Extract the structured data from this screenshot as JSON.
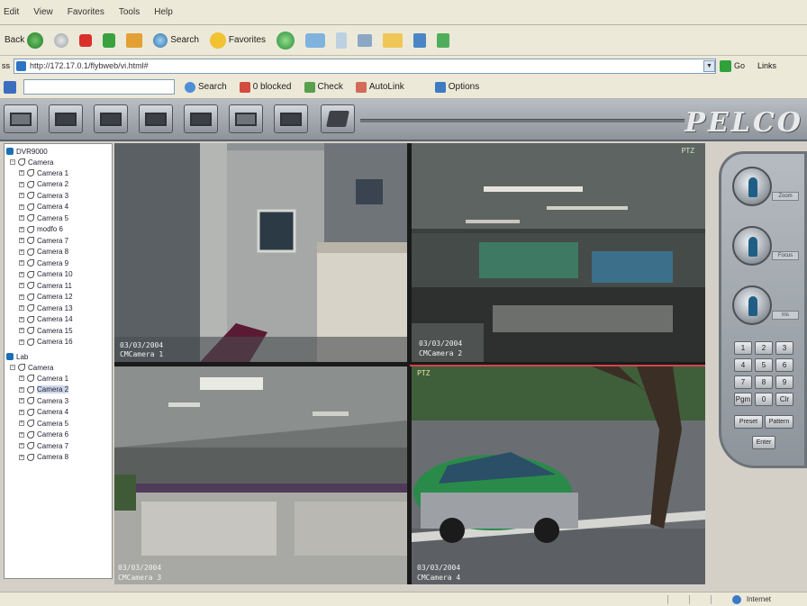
{
  "menu": [
    "Edit",
    "View",
    "Favorites",
    "Tools",
    "Help"
  ],
  "toolbar": {
    "back_label": "Back",
    "search_label": "Search",
    "favorites_label": "Favorites"
  },
  "address": {
    "label": "ss",
    "url": "http://172.17.0.1/flybweb/vi.html#",
    "go_label": "Go",
    "links_label": "Links"
  },
  "google_bar": {
    "search_label": "Search",
    "blocked_label": "0 blocked",
    "check_label": "Check",
    "autolink_label": "AutoLink",
    "options_label": "Options"
  },
  "logo": "PELCO",
  "tree": {
    "group1": {
      "name": "DVR9000",
      "category": "Camera",
      "cameras": [
        "Camera 1",
        "Camera 2",
        "Camera 3",
        "Camera 4",
        "Camera 5",
        "modfo 6",
        "Camera 7",
        "Camera 8",
        "Camera 9",
        "Camera 10",
        "Camera 11",
        "Camera 12",
        "Camera 13",
        "Camera 14",
        "Camera 15",
        "Camera 16"
      ]
    },
    "group2": {
      "name": "Lab",
      "category": "Camera",
      "cameras": [
        "Camera 1",
        "Camera 2",
        "Camera 3",
        "Camera 4",
        "Camera 5",
        "Camera 6",
        "Camera 7",
        "Camera 8"
      ]
    },
    "selected": "group2:Camera 2"
  },
  "video": {
    "tile1": {
      "osd_time": "03/03/2004",
      "osd_name": "CMCamera 1"
    },
    "tile2": {
      "osd_time": "03/03/2004",
      "osd_name": "CMCamera 2",
      "osd_corner": "PTZ"
    },
    "tile3": {
      "osd_time": "03/03/2004",
      "osd_name": "CMCamera 3"
    },
    "tile4": {
      "osd_top": "PTZ",
      "osd_time": "03/03/2004",
      "osd_name": "CMCamera 4"
    }
  },
  "ptz": {
    "dial_tags": [
      "Zoom",
      "Focus",
      "Iris"
    ],
    "keypad": [
      "1",
      "2",
      "3",
      "4",
      "5",
      "6",
      "7",
      "8",
      "9",
      "Pgm",
      "0",
      "Clr"
    ],
    "preset_label": "Preset",
    "pattern_label": "Pattern",
    "enter_label": "Enter"
  },
  "status": {
    "zone": "Internet"
  }
}
